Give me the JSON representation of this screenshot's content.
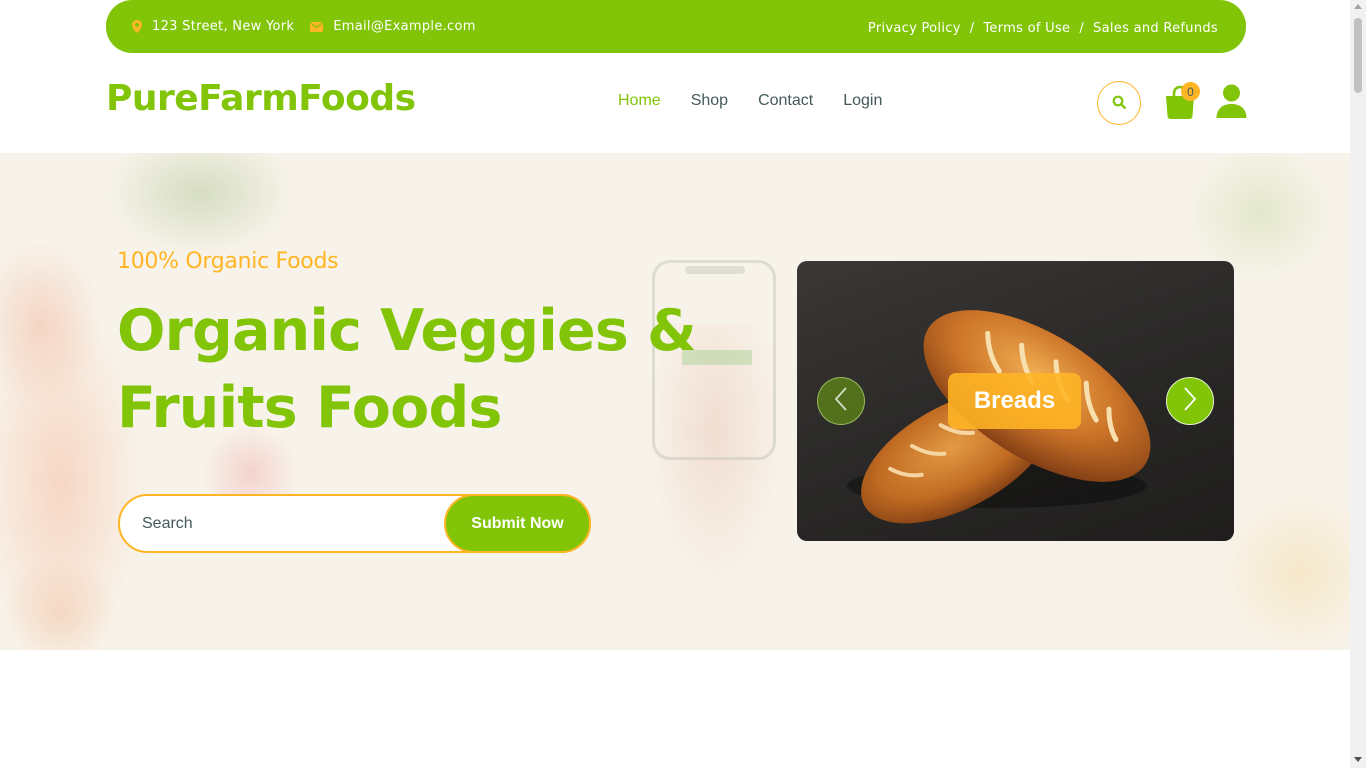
{
  "topbar": {
    "address": "123 Street, New York",
    "email": "Email@Example.com",
    "links": [
      "Privacy Policy",
      "Terms of Use",
      "Sales and Refunds"
    ],
    "separator": "/"
  },
  "header": {
    "logo": "PureFarmFoods",
    "nav": [
      "Home",
      "Shop",
      "Contact",
      "Login"
    ],
    "active_nav": "Home",
    "cart_count": "0"
  },
  "hero": {
    "eyebrow": "100% Organic Foods",
    "headline_line1": "Organic Veggies &",
    "headline_line2": "Fruits Foods",
    "search_placeholder": "Search",
    "submit_label": "Submit Now",
    "carousel": {
      "slide_label": "Breads",
      "slide_image": "bread-loaves"
    }
  },
  "colors": {
    "primary": "#81c408",
    "secondary": "#ffb524",
    "text": "#45595b"
  },
  "icons": [
    "map-pin-icon",
    "envelope-icon",
    "search-icon",
    "shopping-bag-icon",
    "user-icon",
    "chevron-left-icon",
    "chevron-right-icon"
  ]
}
